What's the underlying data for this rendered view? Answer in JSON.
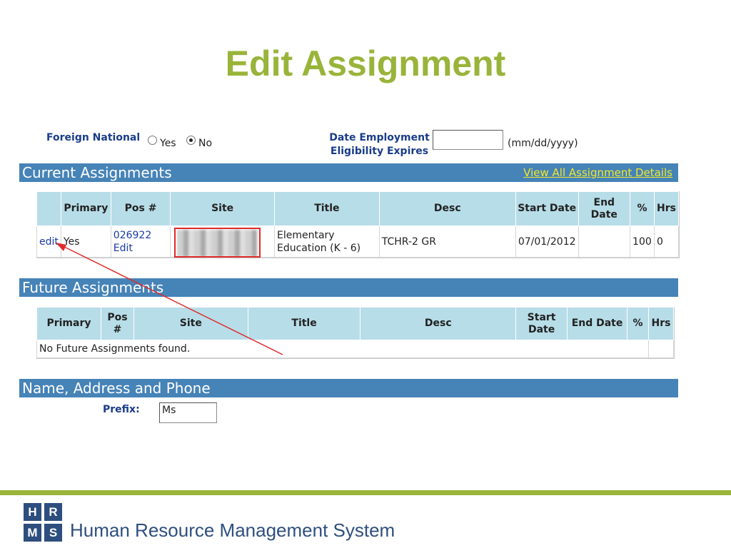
{
  "slide": {
    "title": "Edit Assignment"
  },
  "form": {
    "foreign_national_label": "Foreign National",
    "yes_label": "Yes",
    "no_label": "No",
    "selected": "No",
    "date_label_line1": "Date Employment",
    "date_label_line2": "Eligibility Expires",
    "date_value": "",
    "date_hint": "(mm/dd/yyyy)"
  },
  "current": {
    "band_title": "Current Assignments",
    "view_all_link": "View All Assignment Details",
    "headers": [
      "",
      "Primary",
      "Pos #",
      "Site",
      "Title",
      "Desc",
      "Start Date",
      "End Date",
      "%",
      "Hrs"
    ],
    "row": {
      "action": "edit",
      "primary": "Yes",
      "pos": "026922",
      "pos_edit": "Edit",
      "title_line1": "Elementary",
      "title_line2": "Education (K - 6)",
      "desc": "TCHR-2 GR",
      "start_date": "07/01/2012",
      "end_date": "",
      "percent": "100",
      "hrs": "0"
    }
  },
  "future": {
    "band_title": "Future Assignments",
    "headers": [
      "Primary",
      "Pos #",
      "Site",
      "Title",
      "Desc",
      "Start Date",
      "End Date",
      "%",
      "Hrs"
    ],
    "empty_message": "No Future Assignments found."
  },
  "contact": {
    "band_title": "Name, Address and Phone",
    "prefix_label": "Prefix:",
    "prefix_value": "Ms"
  },
  "footer": {
    "logo_letters": [
      "H",
      "R",
      "M",
      "S"
    ],
    "text": "Human Resource Management System"
  },
  "colors": {
    "accent_green": "#99b43a",
    "band_blue": "#4683b7",
    "header_cyan": "#b7dde8",
    "annotation_red": "#e02b2b"
  }
}
